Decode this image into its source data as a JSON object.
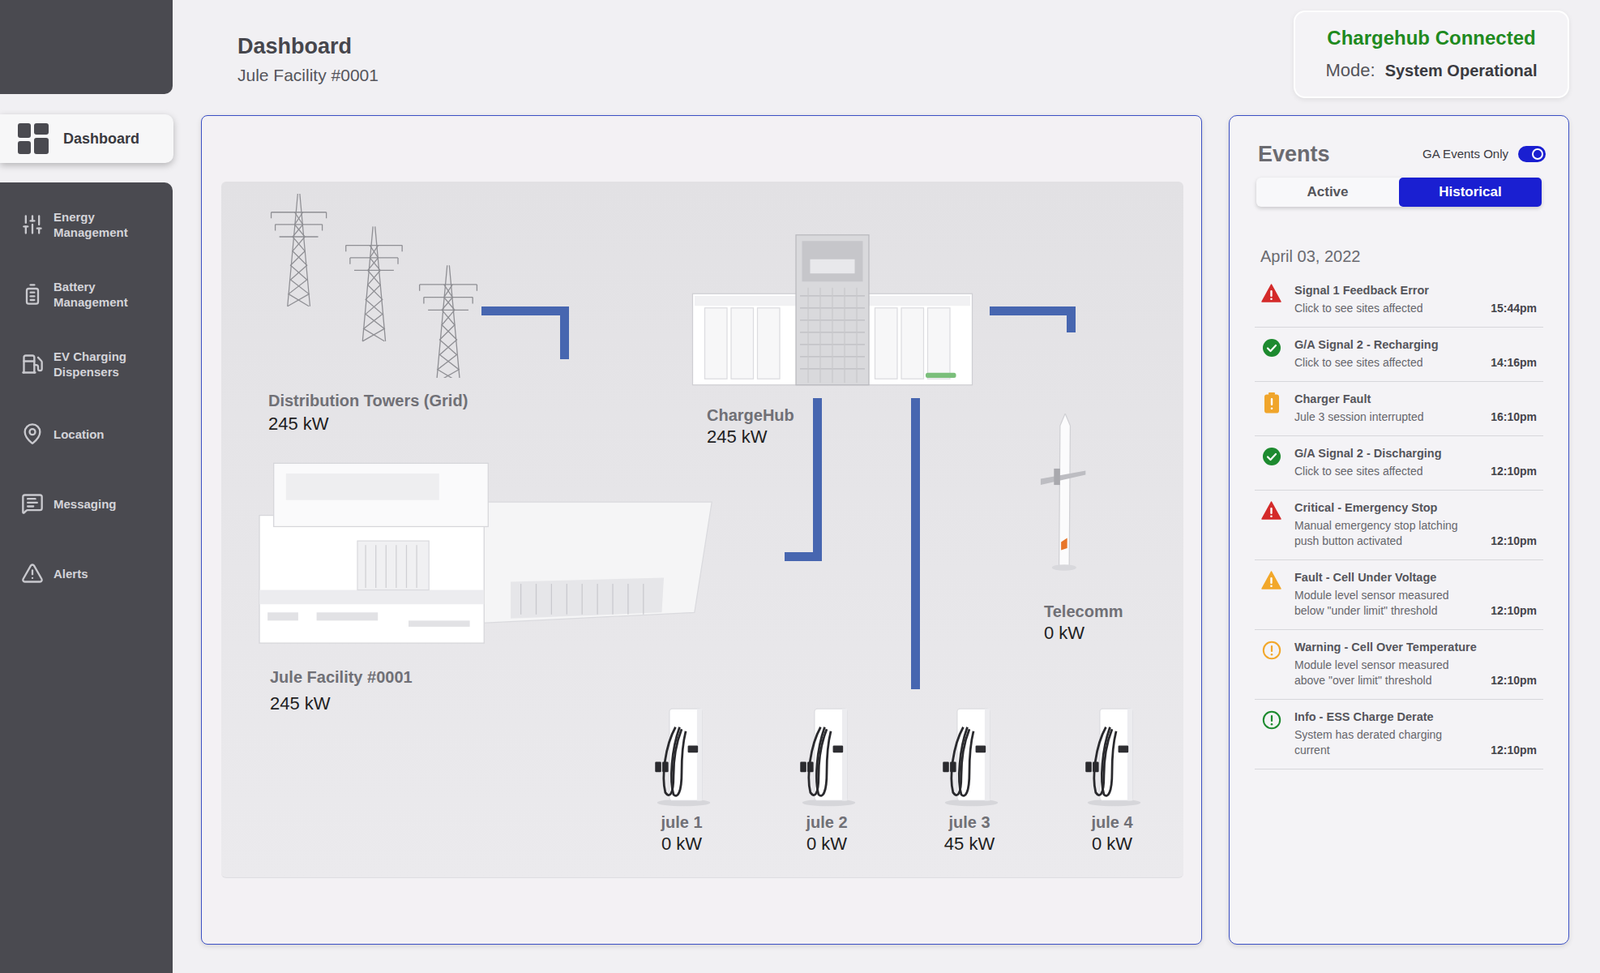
{
  "sidebar": {
    "items": [
      {
        "label": "Dashboard",
        "selected": true
      },
      {
        "label": "Energy Management",
        "selected": false
      },
      {
        "label": "Battery Management",
        "selected": false
      },
      {
        "label": "EV Charging Dispensers",
        "selected": false
      },
      {
        "label": "Location",
        "selected": false
      },
      {
        "label": "Messaging",
        "selected": false
      },
      {
        "label": "Alerts",
        "selected": false
      }
    ]
  },
  "header": {
    "title": "Dashboard",
    "subtitle": "Jule Facility #0001"
  },
  "status": {
    "connection": "Chargehub Connected",
    "mode_label": "Mode:",
    "mode": "System Operational"
  },
  "diagram": {
    "grid": {
      "label": "Distribution Towers (Grid)",
      "power": "245 kW"
    },
    "chargehub": {
      "label": "ChargeHub",
      "power": "245 kW"
    },
    "facility": {
      "label": "Jule Facility #0001",
      "power": "245 kW"
    },
    "telecom": {
      "label": "Telecomm",
      "power": "0 kW"
    },
    "chargers": [
      {
        "label": "jule 1",
        "power": "0 kW"
      },
      {
        "label": "jule 2",
        "power": "0 kW"
      },
      {
        "label": "jule 3",
        "power": "45 kW"
      },
      {
        "label": "jule 4",
        "power": "0 kW"
      }
    ]
  },
  "events": {
    "title": "Events",
    "filter": {
      "label": "GA Events Only",
      "on": true
    },
    "tabs": [
      {
        "label": "Active",
        "selected": false
      },
      {
        "label": "Historical",
        "selected": true
      }
    ],
    "date": "April 03, 2022",
    "items": [
      {
        "title": "Signal 1 Feedback Error",
        "description": "Click to see sites affected",
        "time": "15:44pm",
        "kind": "triangle",
        "color": "#d42a2a"
      },
      {
        "title": "G/A Signal 2 - Recharging",
        "description": "Click to see sites affected",
        "time": "14:16pm",
        "kind": "check",
        "color": "#1d8a2f"
      },
      {
        "title": "Charger Fault",
        "description": "Jule 3 session interrupted",
        "time": "16:10pm",
        "kind": "battery",
        "color": "#f0a52b"
      },
      {
        "title": "G/A Signal 2 - Discharging",
        "description": "Click to see sites affected",
        "time": "12:10pm",
        "kind": "check",
        "color": "#1d8a2f"
      },
      {
        "title": "Critical - Emergency Stop",
        "description": "Manual emergency stop latching push button activated",
        "time": "12:10pm",
        "kind": "triangle",
        "color": "#d42a2a"
      },
      {
        "title": "Fault - Cell Under Voltage",
        "description": "Module level sensor measured below \"under limit\" threshold",
        "time": "12:10pm",
        "kind": "triangle",
        "color": "#f2a72a"
      },
      {
        "title": "Warning - Cell Over Temperature",
        "description": "Module level sensor measured above \"over limit\" threshold",
        "time": "12:10pm",
        "kind": "circle",
        "color": "#f2a72a"
      },
      {
        "title": "Info - ESS Charge Derate",
        "description": "System has derated charging current",
        "time": "12:10pm",
        "kind": "circle",
        "color": "#1d8a2f"
      }
    ]
  }
}
